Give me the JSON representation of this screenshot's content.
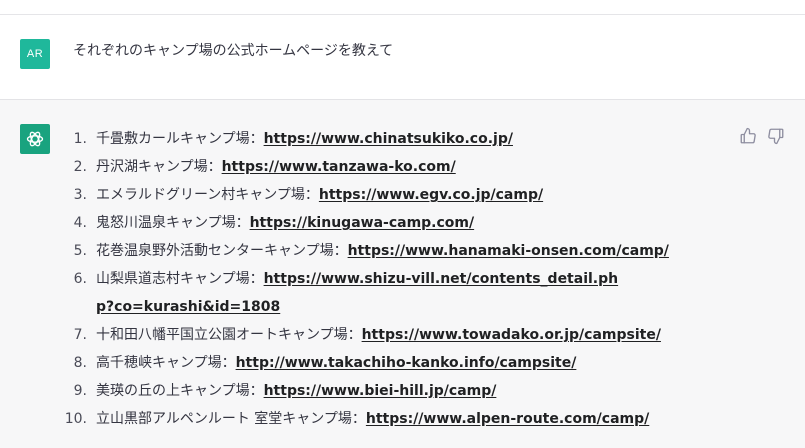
{
  "user": {
    "avatar_initials": "AR",
    "message": "それぞれのキャンプ場の公式ホームページを教えて"
  },
  "assistant": {
    "items": [
      {
        "num": "1.",
        "name": "千畳敷カールキャンプ場：",
        "url": "https://www.chinatsukiko.co.jp/"
      },
      {
        "num": "2.",
        "name": "丹沢湖キャンプ場：",
        "url": "https://www.tanzawa-ko.com/"
      },
      {
        "num": "3.",
        "name": "エメラルドグリーン村キャンプ場：",
        "url": "https://www.egv.co.jp/camp/"
      },
      {
        "num": "4.",
        "name": "鬼怒川温泉キャンプ場：",
        "url": "https://kinugawa-camp.com/"
      },
      {
        "num": "5.",
        "name": "花巻温泉野外活動センターキャンプ場：",
        "url": "https://www.hanamaki-onsen.com/camp/"
      },
      {
        "num": "6.",
        "name": "山梨県道志村キャンプ場：",
        "url": "https://www.shizu-vill.net/contents_detail.php?co=kurashi&id=1808"
      },
      {
        "num": "7.",
        "name": "十和田八幡平国立公園オートキャンプ場：",
        "url": "https://www.towadako.or.jp/campsite/"
      },
      {
        "num": "8.",
        "name": "高千穂峡キャンプ場：",
        "url": "http://www.takachiho-kanko.info/campsite/"
      },
      {
        "num": "9.",
        "name": "美瑛の丘の上キャンプ場：",
        "url": "https://www.biei-hill.jp/camp/"
      },
      {
        "num": "10.",
        "name": "立山黒部アルペンルート 室堂キャンプ場：",
        "url": "https://www.alpen-route.com/camp/"
      }
    ],
    "icons": {
      "thumbs_up": "thumbs-up-icon",
      "thumbs_down": "thumbs-down-icon"
    }
  },
  "colors": {
    "user_avatar": "#1fb89b",
    "bot_avatar": "#19a37f",
    "assistant_bg": "#f7f7f8"
  }
}
